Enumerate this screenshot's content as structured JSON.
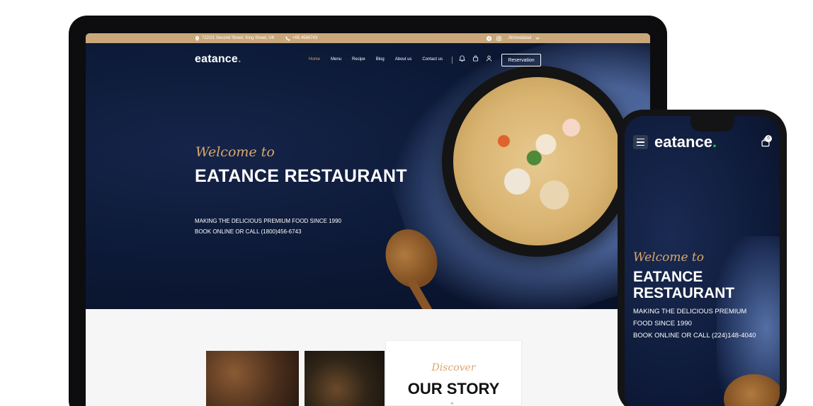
{
  "desktop": {
    "topbar": {
      "address": "722/21 Second Street, King Street, UK",
      "phone": "+65 4566743",
      "city": "Ahmedabad"
    },
    "nav": {
      "logo": "eatance",
      "links": [
        "Home",
        "Menu",
        "Recipe",
        "Blog",
        "About us",
        "Contact us"
      ],
      "active_link": "Home",
      "reservation_label": "Reservation"
    },
    "hero": {
      "welcome": "Welcome to",
      "title": "EATANCE RESTAURANT",
      "subtitle_line1": "MAKING THE DELICIOUS PREMIUM FOOD SINCE 1990",
      "subtitle_line2": "BOOK ONLINE OR CALL (1800)456-6743"
    },
    "story": {
      "discover": "Discover",
      "title": "OUR STORY"
    }
  },
  "mobile": {
    "logo": "eatance",
    "cart_count": "0",
    "hero": {
      "welcome": "Welcome to",
      "title_line1": "EATANCE",
      "title_line2": "RESTAURANT",
      "subtitle_line1": "MAKING THE DELICIOUS PREMIUM",
      "subtitle_line2": "FOOD SINCE 1990",
      "subtitle_line3": "BOOK ONLINE OR CALL (224)148-4040"
    }
  },
  "colors": {
    "accent_gold": "#d9a76b",
    "topbar": "#c9a77a",
    "hero_navy": "#0d1a38",
    "logo_dot_green": "#2fbf4a"
  },
  "icons": [
    "location-icon",
    "phone-icon",
    "facebook-icon",
    "instagram-icon",
    "chevron-down-icon",
    "bell-icon",
    "bag-icon",
    "user-icon",
    "hamburger-menu-icon",
    "cart-icon"
  ]
}
